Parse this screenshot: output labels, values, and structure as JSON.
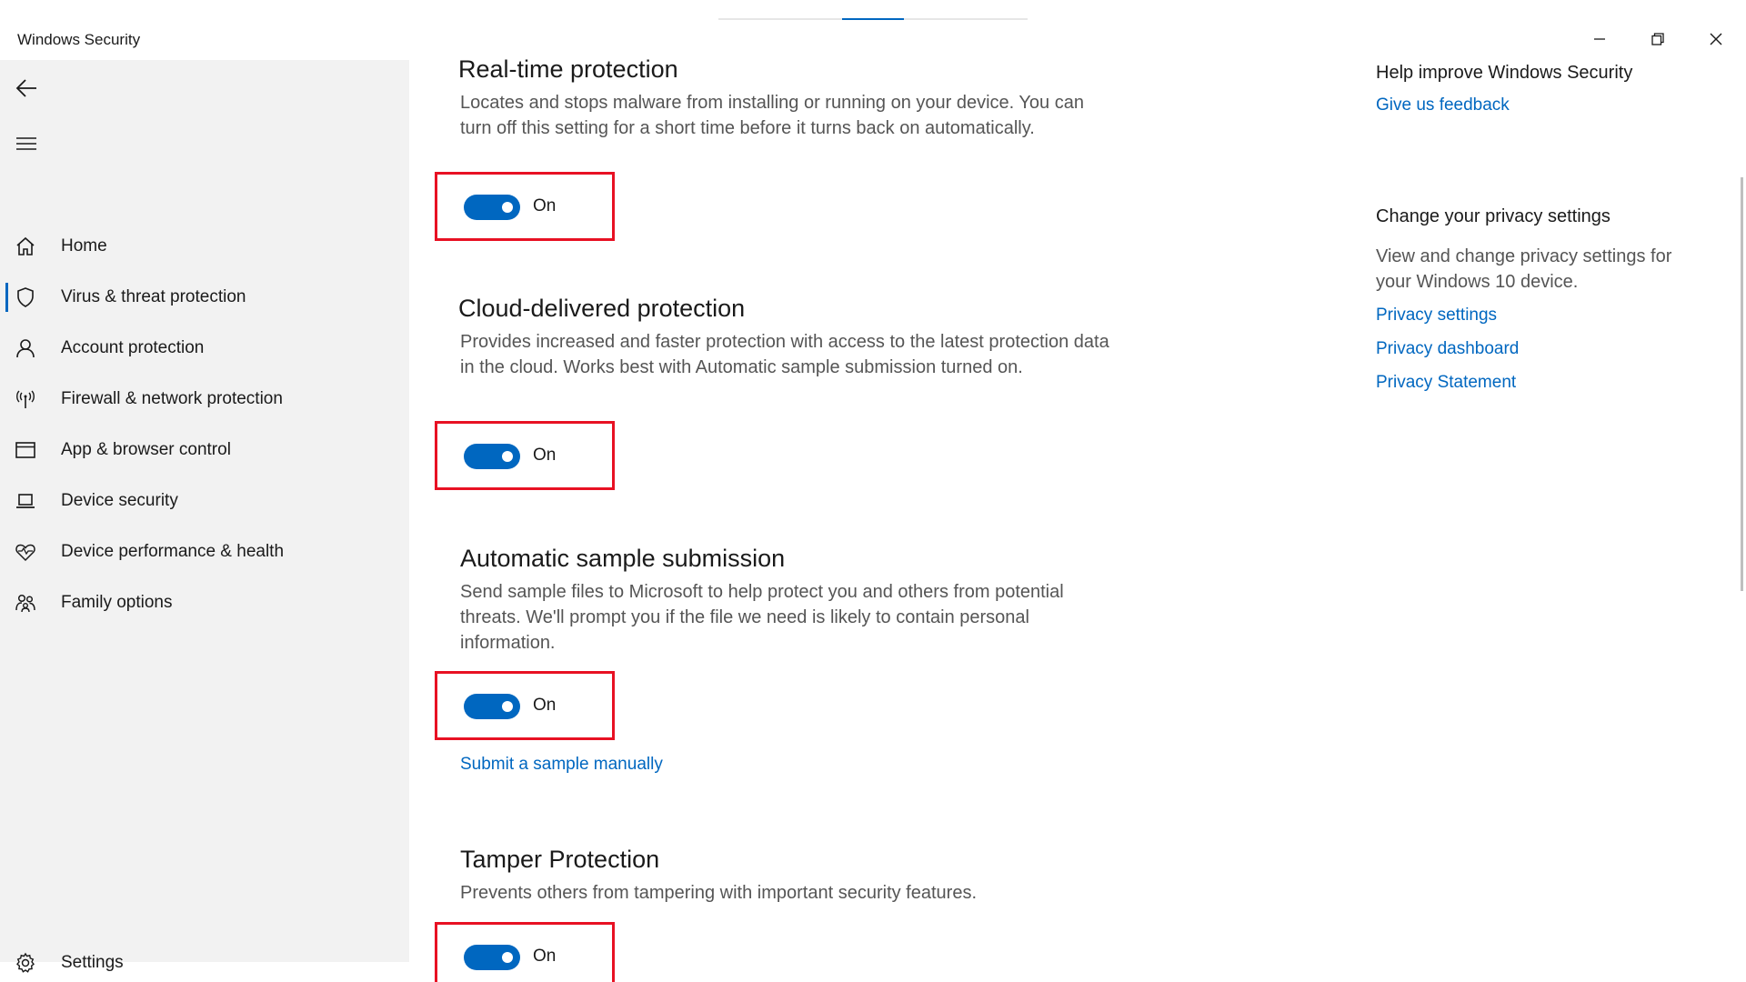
{
  "window": {
    "title": "Windows Security",
    "controls": {
      "minimize": "minimize-icon",
      "maximize": "restore-icon",
      "close": "close-icon"
    }
  },
  "sidebar": {
    "back_icon": "back-arrow-icon",
    "menu_icon": "hamburger-icon",
    "items": [
      {
        "label": "Home",
        "icon": "home-icon"
      },
      {
        "label": "Virus & threat protection",
        "icon": "shield-icon",
        "active": true
      },
      {
        "label": "Account protection",
        "icon": "person-icon"
      },
      {
        "label": "Firewall & network protection",
        "icon": "antenna-icon"
      },
      {
        "label": "App & browser control",
        "icon": "browser-window-icon"
      },
      {
        "label": "Device security",
        "icon": "laptop-icon"
      },
      {
        "label": "Device performance & health",
        "icon": "heart-pulse-icon"
      },
      {
        "label": "Family options",
        "icon": "family-icon"
      }
    ],
    "settings": {
      "label": "Settings",
      "icon": "gear-icon"
    }
  },
  "main": {
    "sections": [
      {
        "title": "Real-time protection",
        "description": "Locates and stops malware from installing or running on your device. You can turn off this setting for a short time before it turns back on automatically.",
        "toggle_state": "On",
        "toggle_on": true
      },
      {
        "title": "Cloud-delivered protection",
        "description": "Provides increased and faster protection with access to the latest protection data in the cloud. Works best with Automatic sample submission turned on.",
        "toggle_state": "On",
        "toggle_on": true
      },
      {
        "title": "Automatic sample submission",
        "description": "Send sample files to Microsoft to help protect you and others from potential threats. We'll prompt you if the file we need is likely to contain personal information.",
        "toggle_state": "On",
        "toggle_on": true,
        "link": "Submit a sample manually"
      },
      {
        "title": "Tamper Protection",
        "description": "Prevents others from tampering with important security features.",
        "toggle_state": "On",
        "toggle_on": true
      }
    ]
  },
  "right_panel": {
    "feedback": {
      "title": "Help improve Windows Security",
      "link": "Give us feedback"
    },
    "privacy": {
      "title": "Change your privacy settings",
      "description": "View and change privacy settings for your Windows 10 device.",
      "links": [
        "Privacy settings",
        "Privacy dashboard",
        "Privacy Statement"
      ]
    }
  },
  "colors": {
    "accent": "#0067c0",
    "highlight_box": "#e81123",
    "sidebar_bg": "#f2f2f2"
  }
}
